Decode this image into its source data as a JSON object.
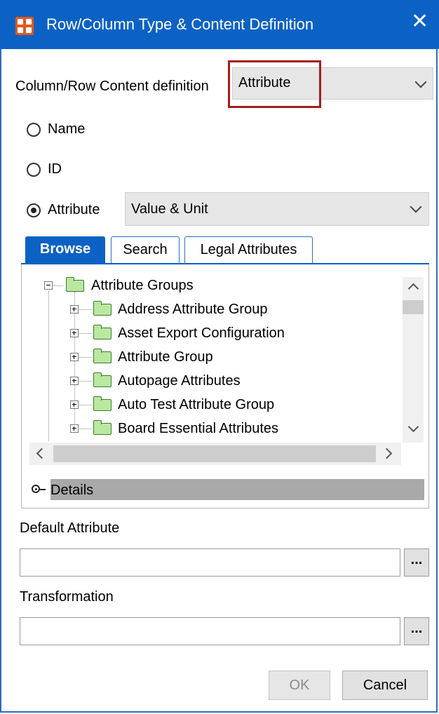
{
  "window": {
    "title": "Row/Column Type & Content Definition",
    "close_symbol": "✕",
    "accent_color": "#0b62c4",
    "highlight_color": "#a31d1d"
  },
  "content_definition": {
    "label": "Column/Row Content definition",
    "selected": "Attribute"
  },
  "radio_options": {
    "name": "Name",
    "id": "ID",
    "attribute": "Attribute",
    "selected": "Attribute"
  },
  "attribute_mode": {
    "selected": "Value & Unit"
  },
  "tabs": [
    {
      "label": "Browse",
      "active": true
    },
    {
      "label": "Search",
      "active": false
    },
    {
      "label": "Legal Attributes",
      "active": false
    }
  ],
  "tree": {
    "root": {
      "label": "Attribute Groups",
      "expanded": true
    },
    "children": [
      {
        "label": "Address Attribute Group"
      },
      {
        "label": "Asset Export Configuration"
      },
      {
        "label": "Attribute Group"
      },
      {
        "label": "Autopage Attributes"
      },
      {
        "label": "Auto Test Attribute Group"
      },
      {
        "label": "Board Essential Attributes"
      }
    ]
  },
  "details": {
    "label": "Details"
  },
  "default_attribute": {
    "label": "Default Attribute",
    "value": "",
    "browse_label": "..."
  },
  "transformation": {
    "label": "Transformation",
    "value": "",
    "browse_label": "..."
  },
  "buttons": {
    "ok": {
      "label": "OK",
      "enabled": false
    },
    "cancel": {
      "label": "Cancel",
      "enabled": true
    }
  }
}
